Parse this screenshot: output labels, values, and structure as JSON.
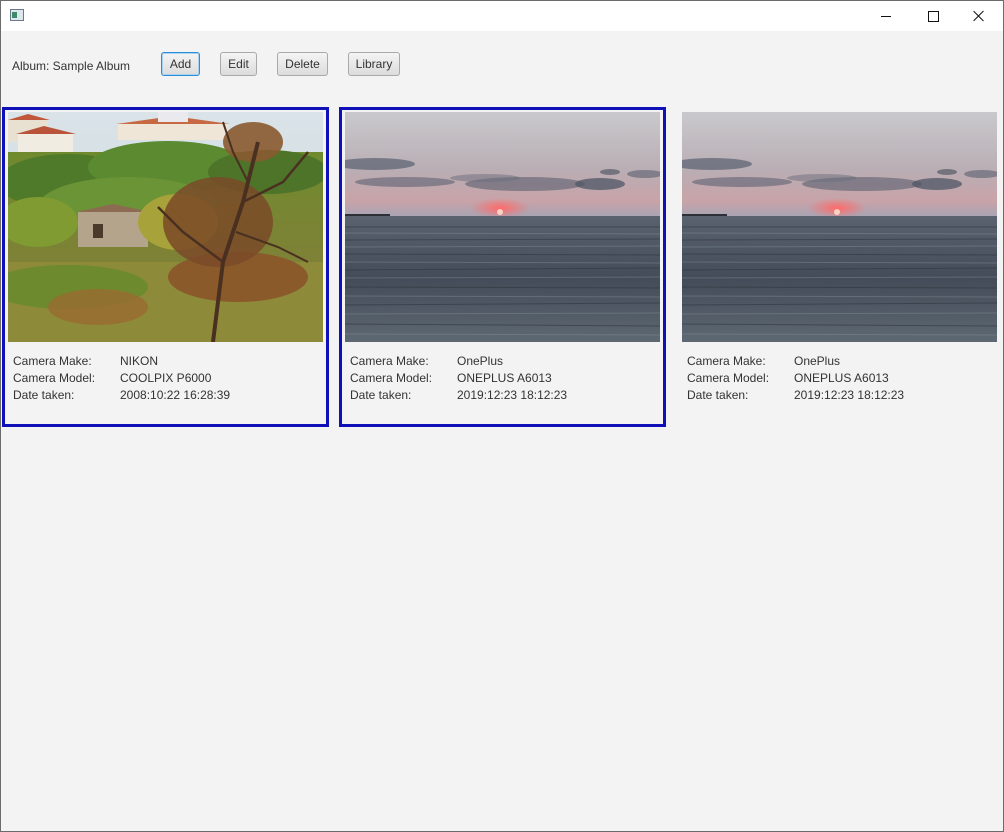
{
  "toolbar": {
    "album_label": "Album: Sample Album",
    "add_label": "Add",
    "edit_label": "Edit",
    "delete_label": "Delete",
    "library_label": "Library"
  },
  "photos": [
    {
      "selected": true,
      "scene": "countryside",
      "make_label": "Camera Make:",
      "make": "NIKON",
      "model_label": "Camera Model:",
      "model": "COOLPIX P6000",
      "date_label": "Date taken:",
      "date": "2008:10:22 16:28:39"
    },
    {
      "selected": true,
      "scene": "sunset-sea",
      "make_label": "Camera Make:",
      "make": "OnePlus",
      "model_label": "Camera Model:",
      "model": "ONEPLUS A6013",
      "date_label": "Date taken:",
      "date": "2019:12:23 18:12:23"
    },
    {
      "selected": false,
      "scene": "sunset-sea",
      "make_label": "Camera Make:",
      "make": "OnePlus",
      "model_label": "Camera Model:",
      "model": "ONEPLUS A6013",
      "date_label": "Date taken:",
      "date": "2019:12:23 18:12:23"
    }
  ],
  "colors": {
    "selection_border": "#1010b8",
    "focus_border": "#2b8fd6",
    "background": "#f3f3f3"
  }
}
